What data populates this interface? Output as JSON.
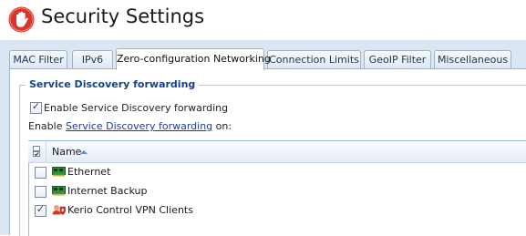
{
  "header": {
    "title": "Security Settings",
    "icon": "hand-stop-icon",
    "icon_color": "#d9342b"
  },
  "tabs": [
    {
      "label": "MAC Filter",
      "active": false
    },
    {
      "label": "IPv6",
      "active": false
    },
    {
      "label": "Zero-configuration Networking",
      "active": true
    },
    {
      "label": "Connection Limits",
      "active": false
    },
    {
      "label": "GeoIP Filter",
      "active": false
    },
    {
      "label": "Miscellaneous",
      "active": false
    }
  ],
  "section": {
    "legend": "Service Discovery forwarding",
    "enable_checkbox": {
      "label": "Enable Service Discovery forwarding",
      "checked": true
    },
    "enable_on": {
      "prefix": "Enable ",
      "link": "Service Discovery forwarding",
      "suffix": " on:"
    }
  },
  "grid": {
    "columns": {
      "name": "Name"
    },
    "rows": [
      {
        "name": "Ethernet",
        "checked": false,
        "icon": "network-card-icon"
      },
      {
        "name": "Internet Backup",
        "checked": false,
        "icon": "network-card-icon"
      },
      {
        "name": "Kerio Control VPN Clients",
        "checked": true,
        "icon": "vpn-clients-icon"
      }
    ]
  },
  "colors": {
    "accent": "#15428b",
    "tab_border": "#9db4cf",
    "background": "#dbe6f3"
  }
}
